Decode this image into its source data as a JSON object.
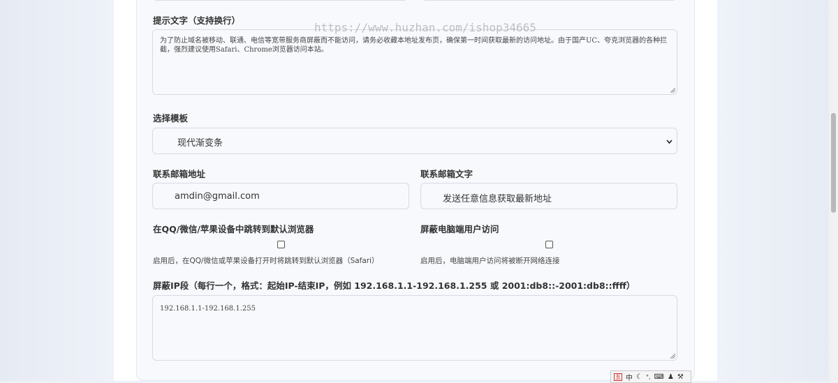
{
  "watermark": "https://www.huzhan.com/ishop34665",
  "hint": {
    "label": "提示文字（支持换行）",
    "text": "为了防止域名被移动、联通、电信等宽带服务商屏蔽而不能访问，请务必收藏本地址发布页，确保第一时间获取最新的访问地址。由于国产UC、夸克浏览器的各种拦截，强烈建议使用Safari、Chrome浏览器访问本站。"
  },
  "template": {
    "label": "选择模板",
    "selected": "现代渐变条"
  },
  "email": {
    "label": "联系邮箱地址",
    "value": "amdin@gmail.com"
  },
  "email_text": {
    "label": "联系邮箱文字",
    "value": "发送任意信息获取最新地址"
  },
  "redirect": {
    "label": "在QQ/微信/苹果设备中跳转到默认浏览器",
    "help": "启用后，在QQ/微信或苹果设备打开时将跳转到默认浏览器（Safari）",
    "checked": false
  },
  "block_pc": {
    "label": "屏蔽电脑端用户访问",
    "help": "启用后，电脑端用户访问将被断开网络连接",
    "checked": false
  },
  "block_ip": {
    "label": "屏蔽IP段（每行一个，格式：起始IP-结束IP，例如 192.168.1.1-192.168.1.255 或 2001:db8::-2001:db8::ffff）",
    "value": "192.168.1.1-192.168.1.255"
  },
  "ime_toolbar": {
    "mode_badge": "五",
    "language": "中",
    "items": [
      "moon-icon",
      "punctuation-icon",
      "keyboard-icon",
      "user-icon",
      "wrench-icon"
    ]
  }
}
